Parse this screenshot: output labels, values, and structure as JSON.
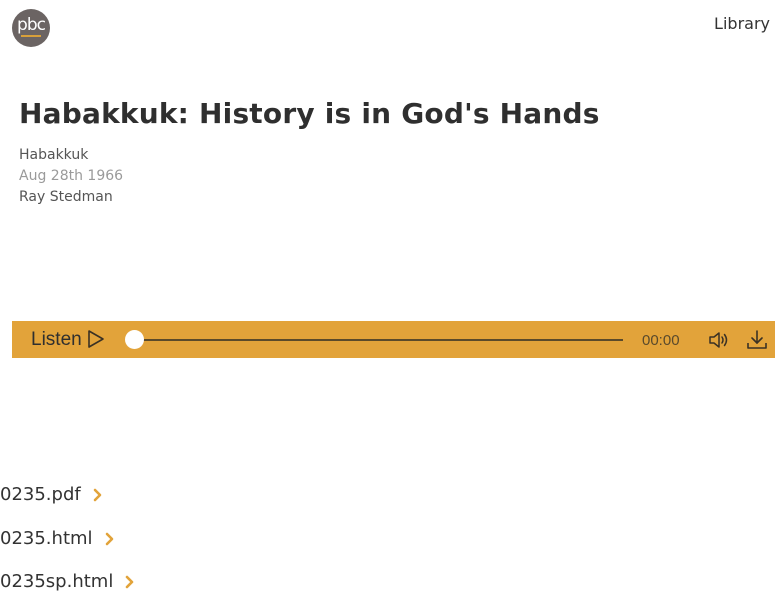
{
  "header": {
    "logo_text": "pbc",
    "nav_library": "Library",
    "logo_color": "#6b6463",
    "logo_accent": "#d8a03a"
  },
  "message": {
    "title": "Habakkuk: History is in God's Hands",
    "book": "Habakkuk",
    "date": "Aug 28th 1966",
    "speaker": "Ray Stedman"
  },
  "player": {
    "label": "Listen",
    "time": "00:00",
    "progress": 0,
    "background": "#e2a33a",
    "icons": [
      "play-icon",
      "volume-icon",
      "download-icon"
    ]
  },
  "files": [
    {
      "name": "0235.pdf"
    },
    {
      "name": "0235.html"
    },
    {
      "name": "0235sp.html"
    }
  ],
  "accent_color": "#e2a33a"
}
